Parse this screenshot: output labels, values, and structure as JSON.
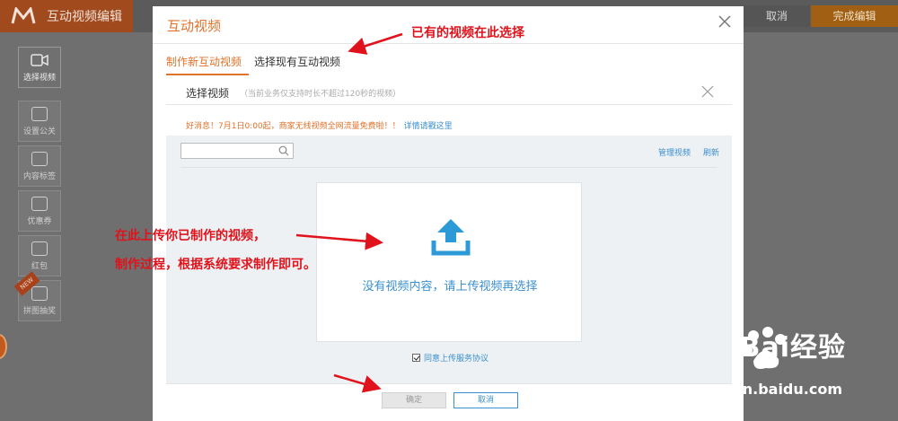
{
  "app": {
    "title": "互动视频编辑",
    "cancel_label": "取消",
    "finish_label": "完成编辑"
  },
  "sidebar": {
    "tools": [
      {
        "label": "选择视频"
      },
      {
        "label": "设置公关"
      },
      {
        "label": "内容标签"
      },
      {
        "label": "优惠券"
      },
      {
        "label": "红包"
      },
      {
        "label": "拼图抽奖"
      }
    ],
    "new_badge": "NEW"
  },
  "modal": {
    "title": "互动视频",
    "tabs": [
      {
        "label": "制作新互动视频"
      },
      {
        "label": "选择现有互动视频"
      }
    ],
    "inner_title": "选择视频",
    "inner_note": "（当前业务仅支持时长不超过120秒的视频）",
    "notice": "好消息！7月1日0:00起，商家无线视频全网流量免费啦！！",
    "notice_link": "详情请戳这里",
    "search_placeholder": "",
    "manage_label": "管理视频",
    "refresh_label": "刷新",
    "empty_text": "没有视频内容，请上传视频再选择",
    "agree_label": "同意上传服务协议",
    "confirm_label": "确定",
    "cancel_label": "取消"
  },
  "annotations": {
    "existing": "已有的视频在此选择",
    "upload_line1": "在此上传你已制作的视频，",
    "upload_line2": "制作过程，根据系统要求制作即可。"
  },
  "watermark": {
    "brand": "Bai经验",
    "url": "jingyan.baidu.com"
  },
  "colors": {
    "accent": "#e0722b",
    "link": "#3a8fcf",
    "annotation": "#e0121b",
    "brand_orange": "#a04a1e"
  }
}
